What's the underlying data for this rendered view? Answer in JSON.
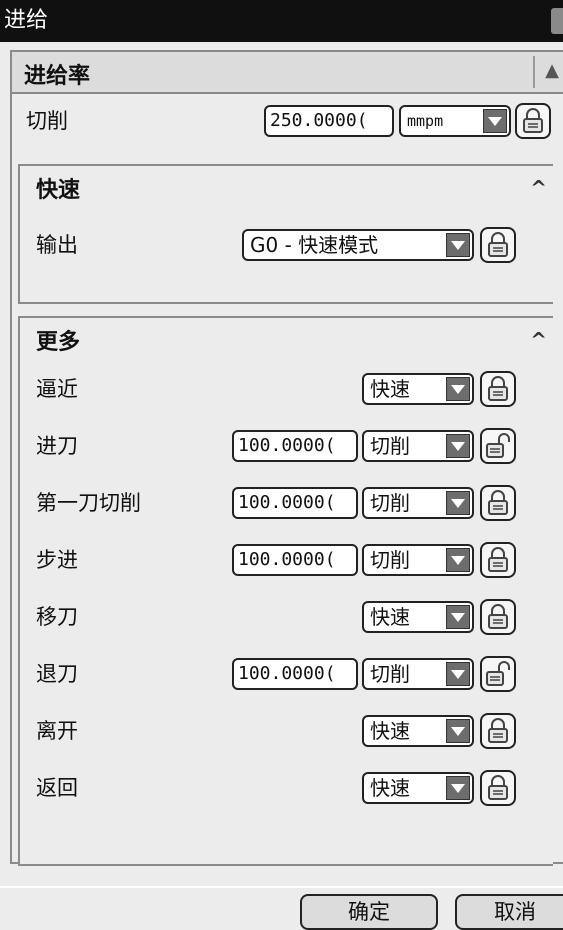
{
  "window": {
    "title": "进给"
  },
  "feed_group": {
    "title": "进给率",
    "cut": {
      "label": "切削",
      "value": "250.0000(",
      "unit": "mmpm"
    }
  },
  "rapid_panel": {
    "title": "快速",
    "output": {
      "label": "输出",
      "value": "G0 - 快速模式"
    }
  },
  "more_panel": {
    "title": "更多",
    "rows": [
      {
        "label": "逼近",
        "value": "",
        "mode": "快速",
        "locked": true
      },
      {
        "label": "进刀",
        "value": "100.0000(",
        "mode": "切削",
        "locked": false
      },
      {
        "label": "第一刀切削",
        "value": "100.0000(",
        "mode": "切削",
        "locked": true
      },
      {
        "label": "步进",
        "value": "100.0000(",
        "mode": "切削",
        "locked": true
      },
      {
        "label": "移刀",
        "value": "",
        "mode": "快速",
        "locked": true
      },
      {
        "label": "退刀",
        "value": "100.0000(",
        "mode": "切削",
        "locked": false
      },
      {
        "label": "离开",
        "value": "",
        "mode": "快速",
        "locked": true
      },
      {
        "label": "返回",
        "value": "",
        "mode": "快速",
        "locked": true
      }
    ]
  },
  "buttons": {
    "ok": "确定",
    "cancel": "取消"
  },
  "icons": {
    "lock": "lock-icon",
    "unlock": "unlock-icon",
    "dropdown": "chevron-down-icon",
    "collapse": "chevron-up-icon"
  }
}
